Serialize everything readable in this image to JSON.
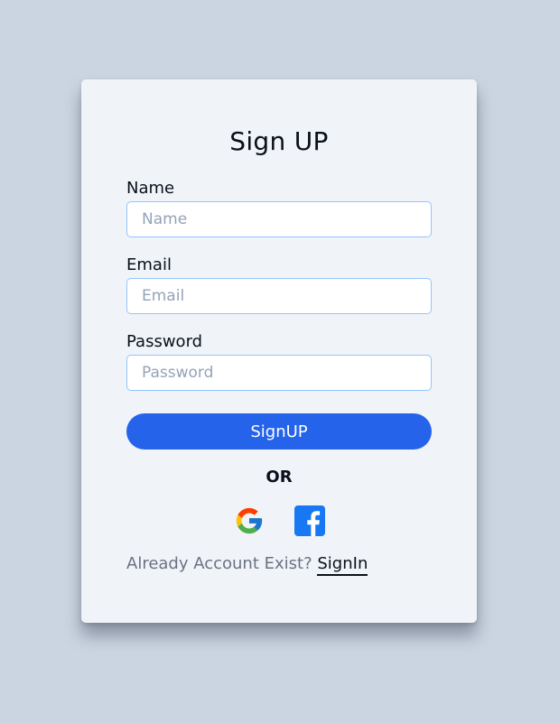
{
  "form": {
    "title": "Sign UP",
    "fields": [
      {
        "label": "Name",
        "placeholder": "Name",
        "value": ""
      },
      {
        "label": "Email",
        "placeholder": "Email",
        "value": ""
      },
      {
        "label": "Password",
        "placeholder": "Password",
        "value": ""
      }
    ],
    "submit_label": "SignUP",
    "divider_text": "OR",
    "social": [
      {
        "icon": "google-icon"
      },
      {
        "icon": "facebook-icon"
      }
    ],
    "footer": {
      "prompt": "Already Account Exist?",
      "link_label": "SignIn"
    }
  },
  "colors": {
    "background": "#cbd5e1",
    "card": "#f0f4f9",
    "primary": "#2563eb",
    "input_border": "#93c5fd",
    "facebook": "#1877f2"
  }
}
